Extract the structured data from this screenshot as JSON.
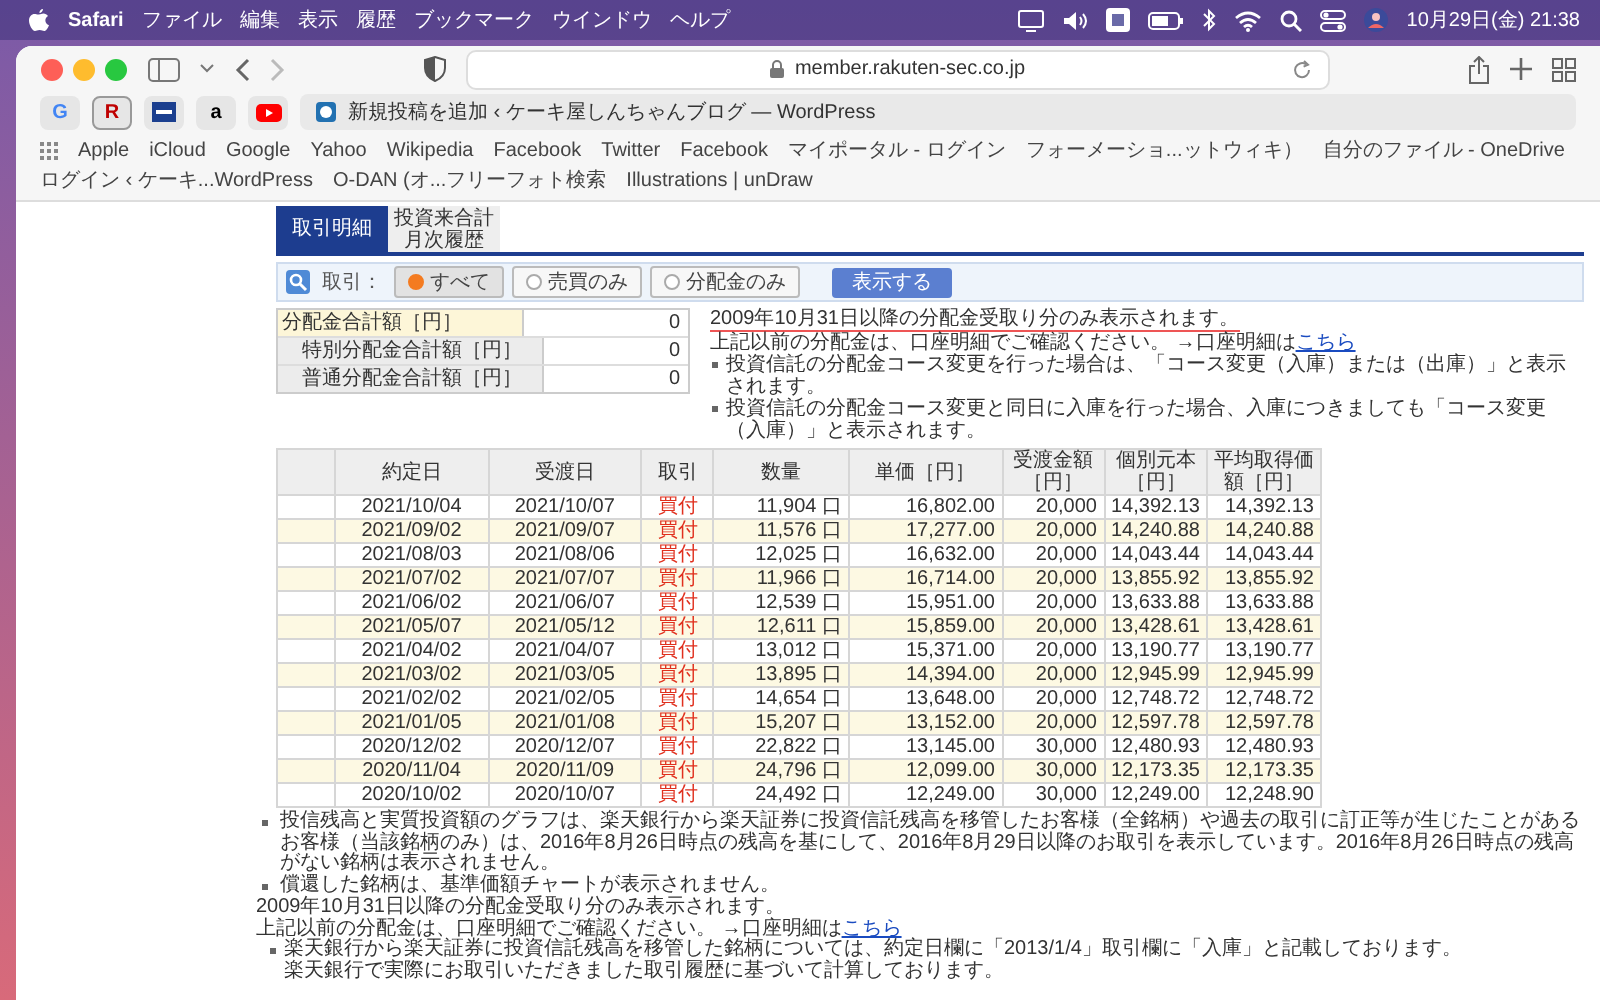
{
  "menubar": {
    "app": "Safari",
    "items": [
      "ファイル",
      "編集",
      "表示",
      "履歴",
      "ブックマーク",
      "ウインドウ",
      "ヘルプ"
    ],
    "clock": "10月29日(金) 21:38"
  },
  "browser": {
    "url": "member.rakuten-sec.co.jp",
    "favorites": [
      {
        "kind": "letter",
        "label": "G"
      },
      {
        "kind": "letter",
        "label": "R"
      },
      {
        "kind": "sbi"
      },
      {
        "kind": "letter",
        "label": "a"
      },
      {
        "kind": "video"
      }
    ],
    "tab_title": "新規投稿を追加 ‹ ケーキ屋しんちゃんブログ — WordPress",
    "bookmarks": [
      "Apple",
      "iCloud",
      "Google",
      "Yahoo",
      "Wikipedia",
      "Facebook",
      "Twitter",
      "Facebook",
      "マイポータル - ログイン",
      "フォーメーショ...ットウィキ）",
      "自分のファイル - OneDrive",
      "ログイン ‹ ケーキ...WordPress",
      "O-DAN (オ...フリーフォト検索",
      "Illustrations | unDraw"
    ]
  },
  "page_tabs": [
    {
      "label": "取引明細",
      "selected": true
    },
    {
      "label": "投資来合計月次履歴",
      "selected": false
    }
  ],
  "filter": {
    "label": "取引：",
    "options": [
      {
        "label": "すべて",
        "selected": true
      },
      {
        "label": "売買のみ",
        "selected": false
      },
      {
        "label": "分配金のみ",
        "selected": false
      }
    ],
    "button": "表示する"
  },
  "summary": [
    {
      "kind": "total",
      "label": "分配金合計額［円］",
      "value": "0"
    },
    {
      "kind": "sub",
      "label": "特別分配金合計額［円］",
      "value": "0"
    },
    {
      "kind": "sub",
      "label": "普通分配金合計額［円］",
      "value": "0"
    }
  ],
  "notice": {
    "headline": "2009年10月31日以降の分配金受取り分のみ表示されます。",
    "line": "上記以前の分配金は、口座明細でご確認ください。 →口座明細は",
    "link": "こちら",
    "bullets": [
      "投資信託の分配金コース変更を行った場合は、「コース変更（入庫）または（出庫）」と表示されます。",
      "投資信託の分配金コース変更と同日に入庫を行った場合、入庫につきましても「コース変更（入庫）」と表示されます。"
    ]
  },
  "table": {
    "columns": [
      "約定日",
      "受渡日",
      "取引",
      "数量",
      "単価［円］",
      "受渡金額［円］",
      "個別元本［円］",
      "平均取得価額［円］"
    ],
    "rows": [
      [
        "2021/10/04",
        "2021/10/07",
        "買付",
        "11,904 口",
        "16,802.00",
        "20,000",
        "14,392.13",
        "14,392.13"
      ],
      [
        "2021/09/02",
        "2021/09/07",
        "買付",
        "11,576 口",
        "17,277.00",
        "20,000",
        "14,240.88",
        "14,240.88"
      ],
      [
        "2021/08/03",
        "2021/08/06",
        "買付",
        "12,025 口",
        "16,632.00",
        "20,000",
        "14,043.44",
        "14,043.44"
      ],
      [
        "2021/07/02",
        "2021/07/07",
        "買付",
        "11,966 口",
        "16,714.00",
        "20,000",
        "13,855.92",
        "13,855.92"
      ],
      [
        "2021/06/02",
        "2021/06/07",
        "買付",
        "12,539 口",
        "15,951.00",
        "20,000",
        "13,633.88",
        "13,633.88"
      ],
      [
        "2021/05/07",
        "2021/05/12",
        "買付",
        "12,611 口",
        "15,859.00",
        "20,000",
        "13,428.61",
        "13,428.61"
      ],
      [
        "2021/04/02",
        "2021/04/07",
        "買付",
        "13,012 口",
        "15,371.00",
        "20,000",
        "13,190.77",
        "13,190.77"
      ],
      [
        "2021/03/02",
        "2021/03/05",
        "買付",
        "13,895 口",
        "14,394.00",
        "20,000",
        "12,945.99",
        "12,945.99"
      ],
      [
        "2021/02/02",
        "2021/02/05",
        "買付",
        "14,654 口",
        "13,648.00",
        "20,000",
        "12,748.72",
        "12,748.72"
      ],
      [
        "2021/01/05",
        "2021/01/08",
        "買付",
        "15,207 口",
        "13,152.00",
        "20,000",
        "12,597.78",
        "12,597.78"
      ],
      [
        "2020/12/02",
        "2020/12/07",
        "買付",
        "22,822 口",
        "13,145.00",
        "30,000",
        "12,480.93",
        "12,480.93"
      ],
      [
        "2020/11/04",
        "2020/11/09",
        "買付",
        "24,796 口",
        "12,099.00",
        "30,000",
        "12,173.35",
        "12,173.35"
      ],
      [
        "2020/10/02",
        "2020/10/07",
        "買付",
        "24,492 口",
        "12,249.00",
        "30,000",
        "12,249.00",
        "12,248.90"
      ]
    ]
  },
  "footnotes": [
    "投信残高と実質投資額のグラフは、楽天銀行から楽天証券に投資信託残高を移管したお客様（全銘柄）や過去の取引に訂正等が生じたことがあるお客様（当該銘柄のみ）は、2016年8月26日時点の残高を基にして、2016年8月29日以降のお取引を表示しています。2016年8月26日時点の残高がない銘柄は表示されません。",
    "償還した銘柄は、基準価額チャートが表示されません。"
  ],
  "bottom_notice": {
    "headline": "2009年10月31日以降の分配金受取り分のみ表示されます。",
    "line": "上記以前の分配金は、口座明細でご確認ください。 →口座明細は",
    "link": "こちら",
    "note_lines": [
      "楽天銀行から楽天証券に投資信託残高を移管した銘柄については、約定日欄に「2013/1/4」取引欄に「入庫」と記載しております。",
      "楽天銀行で実際にお取引いただきました取引履歴に基づいて計算しております。"
    ]
  }
}
